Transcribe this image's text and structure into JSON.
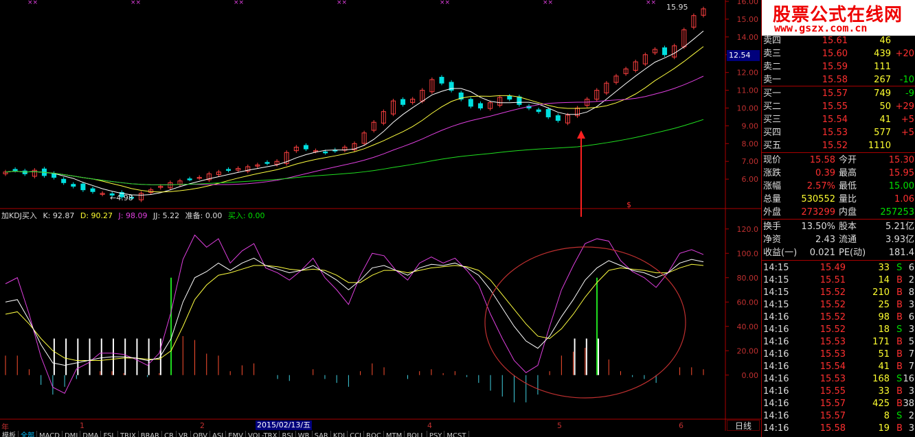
{
  "kdj_legend": {
    "name": "加KDJ买入",
    "k": "K: 92.87",
    "d": "D: 90.27",
    "j": "J: 98.09",
    "jj": "JJ: 5.22",
    "prep": "准备: 0.00",
    "buy": "买入: 0.00"
  },
  "price_axis": [
    "16.00",
    "15.00",
    "14.00",
    "13.00",
    "12.00",
    "11.00",
    "10.00",
    "9.00",
    "8.00",
    "7.00",
    "6.00"
  ],
  "kdj_axis": [
    "120.0",
    "100.0",
    "80.00",
    "60.00",
    "40.00",
    "20.00",
    "0.00"
  ],
  "current_price_tag": "12.54",
  "high_label": "15.95",
  "low_label": "4.98",
  "signal_mark": "$",
  "x_labels": [
    "年",
    "1",
    "2",
    "4",
    "5",
    "6"
  ],
  "date_tag": "2015/02/13/五",
  "period_label": "日线",
  "tabs": [
    "模板",
    "全部",
    "MACD",
    "DMI",
    "DMA",
    "FSL",
    "TRIX",
    "BRAR",
    "CR",
    "VR",
    "OBV",
    "ASI",
    "EMV",
    "VOL-TRX",
    "RSI",
    "WR",
    "SAR",
    "KDJ",
    "CCI",
    "ROC",
    "MTM",
    "BOLL",
    "PSY",
    "MCST"
  ],
  "logo": {
    "title": "股票公式在线网",
    "url": "www.gszx.com.cn"
  },
  "order_book": {
    "asks": [
      {
        "label": "卖四",
        "price": "15.61",
        "vol": "46",
        "chg": ""
      },
      {
        "label": "卖三",
        "price": "15.60",
        "vol": "439",
        "chg": "+20"
      },
      {
        "label": "卖二",
        "price": "15.59",
        "vol": "111",
        "chg": ""
      },
      {
        "label": "卖一",
        "price": "15.58",
        "vol": "267",
        "chg": "-10"
      }
    ],
    "bids": [
      {
        "label": "买一",
        "price": "15.57",
        "vol": "749",
        "chg": "-9"
      },
      {
        "label": "买二",
        "price": "15.55",
        "vol": "50",
        "chg": "+29"
      },
      {
        "label": "买三",
        "price": "15.54",
        "vol": "41",
        "chg": "+5"
      },
      {
        "label": "买四",
        "price": "15.53",
        "vol": "577",
        "chg": "+5"
      },
      {
        "label": "买五",
        "price": "15.52",
        "vol": "1110",
        "chg": ""
      }
    ]
  },
  "quote": [
    {
      "l1": "现价",
      "v1": "15.58",
      "l2": "今开",
      "v2": "15.30"
    },
    {
      "l1": "涨跌",
      "v1": "0.39",
      "l2": "最高",
      "v2": "15.95"
    },
    {
      "l1": "涨幅",
      "v1": "2.57%",
      "l2": "最低",
      "v2": "15.00"
    },
    {
      "l1": "总量",
      "v1": "530552",
      "l2": "量比",
      "v2": "1.06"
    },
    {
      "l1": "外盘",
      "v1": "273299",
      "l2": "内盘",
      "v2": "257253"
    }
  ],
  "fundamentals": [
    {
      "l1": "换手",
      "v1": "13.50%",
      "l2": "股本",
      "v2": "5.21亿"
    },
    {
      "l1": "净资",
      "v1": "2.43",
      "l2": "流通",
      "v2": "3.93亿"
    },
    {
      "l1": "收益(一)",
      "v1": "0.021",
      "l2": "PE(动)",
      "v2": "181.4"
    }
  ],
  "ticks": [
    {
      "time": "14:15",
      "price": "15.49",
      "vol": "33",
      "side": "S",
      "n": "6"
    },
    {
      "time": "14:15",
      "price": "15.51",
      "vol": "14",
      "side": "B",
      "n": "2"
    },
    {
      "time": "14:15",
      "price": "15.52",
      "vol": "210",
      "side": "B",
      "n": "8"
    },
    {
      "time": "14:15",
      "price": "15.52",
      "vol": "25",
      "side": "B",
      "n": "3"
    },
    {
      "time": "14:16",
      "price": "15.52",
      "vol": "98",
      "side": "B",
      "n": "6"
    },
    {
      "time": "14:16",
      "price": "15.52",
      "vol": "18",
      "side": "S",
      "n": "3"
    },
    {
      "time": "14:16",
      "price": "15.53",
      "vol": "171",
      "side": "B",
      "n": "5"
    },
    {
      "time": "14:16",
      "price": "15.53",
      "vol": "51",
      "side": "B",
      "n": "7"
    },
    {
      "time": "14:16",
      "price": "15.54",
      "vol": "41",
      "side": "B",
      "n": "7"
    },
    {
      "time": "14:16",
      "price": "15.53",
      "vol": "168",
      "side": "S",
      "n": "16"
    },
    {
      "time": "14:16",
      "price": "15.55",
      "vol": "33",
      "side": "B",
      "n": "3"
    },
    {
      "time": "14:16",
      "price": "15.57",
      "vol": "425",
      "side": "B",
      "n": "38"
    },
    {
      "time": "14:16",
      "price": "15.57",
      "vol": "8",
      "side": "S",
      "n": "2"
    },
    {
      "time": "14:16",
      "price": "15.58",
      "vol": "19",
      "side": "B",
      "n": "3"
    }
  ],
  "chart_data": {
    "type": "line",
    "price_range": [
      4.5,
      16.0
    ],
    "kdj_range": [
      -30,
      130
    ],
    "close_prices": [
      6.4,
      6.5,
      6.3,
      6.5,
      6.2,
      6.1,
      5.8,
      5.6,
      5.4,
      5.3,
      5.2,
      5.1,
      5.0,
      4.98,
      5.2,
      5.4,
      5.6,
      5.8,
      5.9,
      6.0,
      6.1,
      6.3,
      6.4,
      6.5,
      6.6,
      6.7,
      6.8,
      6.9,
      7.0,
      7.5,
      7.8,
      7.7,
      7.6,
      7.5,
      7.6,
      7.8,
      8.0,
      8.6,
      9.2,
      9.8,
      10.4,
      10.2,
      10.5,
      11.0,
      11.6,
      11.4,
      11.0,
      10.5,
      10.1,
      10.0,
      10.3,
      10.6,
      10.5,
      10.2,
      10.0,
      9.8,
      9.5,
      9.3,
      9.6,
      10.0,
      10.5,
      11.0,
      11.4,
      11.8,
      12.2,
      12.6,
      13.0,
      13.3,
      13.0,
      13.5,
      14.4,
      15.2,
      15.58
    ],
    "kdj_k": [
      60,
      62,
      45,
      25,
      10,
      8,
      10,
      12,
      14,
      15,
      15,
      14,
      12,
      14,
      30,
      60,
      80,
      85,
      92,
      86,
      92,
      96,
      90,
      87,
      84,
      86,
      90,
      84,
      78,
      70,
      78,
      88,
      90,
      86,
      82,
      88,
      91,
      90,
      92,
      88,
      82,
      70,
      55,
      40,
      28,
      22,
      32,
      48,
      62,
      78,
      88,
      94,
      90,
      86,
      84,
      80,
      84,
      92,
      95,
      93
    ],
    "kdj_d": [
      50,
      52,
      42,
      30,
      20,
      14,
      12,
      12,
      12,
      13,
      14,
      14,
      13,
      13,
      20,
      40,
      62,
      74,
      82,
      84,
      87,
      90,
      90,
      89,
      87,
      86,
      87,
      86,
      82,
      76,
      76,
      82,
      86,
      86,
      84,
      86,
      88,
      89,
      90,
      89,
      86,
      78,
      66,
      54,
      42,
      32,
      30,
      38,
      50,
      64,
      76,
      86,
      88,
      87,
      86,
      84,
      84,
      88,
      91,
      90
    ],
    "kdj_j": [
      75,
      80,
      50,
      15,
      -10,
      -15,
      5,
      10,
      18,
      18,
      17,
      13,
      8,
      18,
      52,
      95,
      115,
      105,
      112,
      92,
      102,
      108,
      88,
      84,
      78,
      86,
      96,
      80,
      70,
      58,
      82,
      100,
      98,
      86,
      78,
      92,
      97,
      92,
      96,
      86,
      74,
      50,
      30,
      12,
      2,
      8,
      40,
      70,
      90,
      108,
      112,
      110,
      94,
      85,
      80,
      72,
      84,
      100,
      103,
      99
    ]
  }
}
